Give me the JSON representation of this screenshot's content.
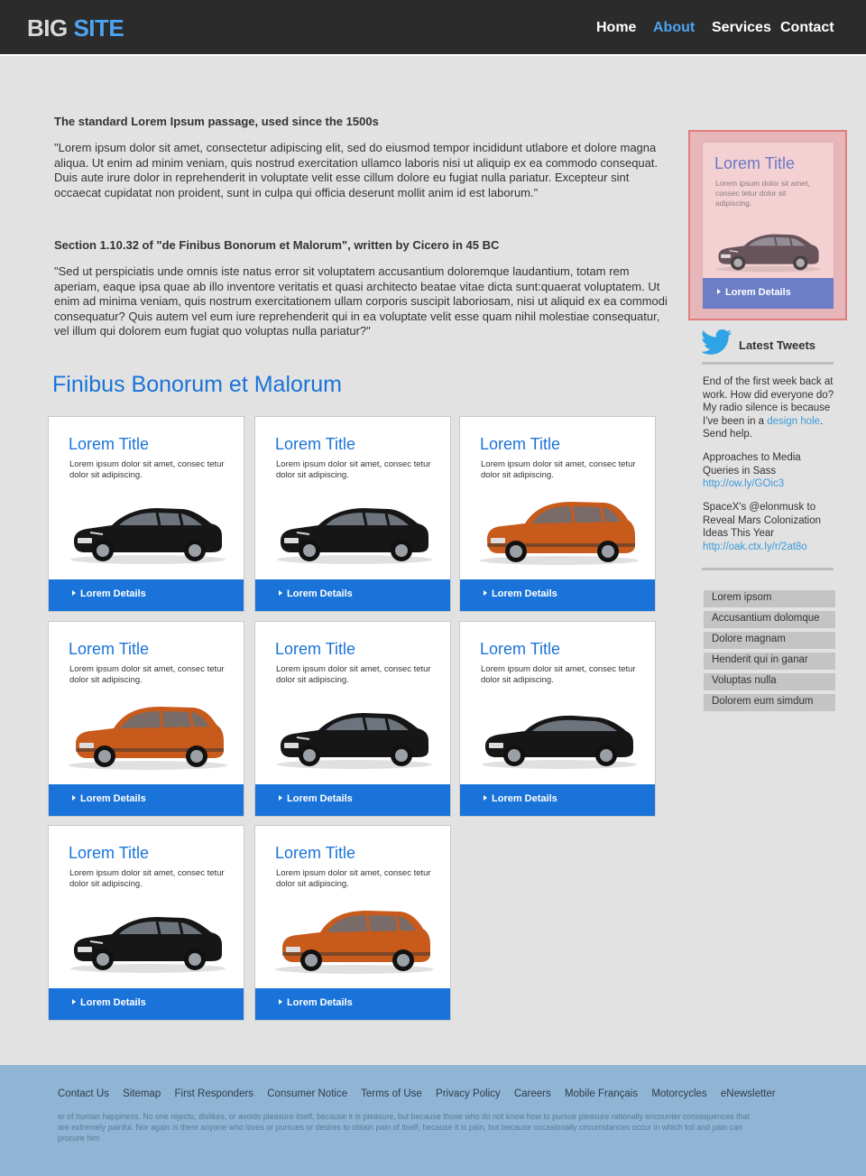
{
  "header": {
    "logo_part1": "BIG",
    "logo_part2": "SITE",
    "nav": [
      "Home",
      "About",
      "Services",
      "Contact"
    ],
    "active_nav": "About"
  },
  "intro": [
    {
      "heading": "The standard Lorem Ipsum passage, used since the 1500s",
      "body": "\"Lorem ipsum dolor sit amet, consectetur adipiscing elit, sed do eiusmod tempor incididunt utlabore et dolore magna aliqua. Ut enim ad minim veniam, quis nostrud exercitation ullamco laboris nisi ut aliquip ex ea commodo consequat. Duis aute irure dolor in reprehenderit in voluptate velit esse cillum dolore eu fugiat nulla pariatur. Excepteur sint occaecat cupidatat non proident, sunt in culpa qui officia deserunt mollit anim id est laborum.\""
    },
    {
      "heading": "Section 1.10.32 of \"de Finibus Bonorum et Malorum\", written by Cicero in 45 BC",
      "body": "\"Sed ut perspiciatis unde omnis iste natus error sit voluptatem accusantium doloremque laudantium, totam rem aperiam, eaque ipsa quae ab illo inventore veritatis et quasi architecto beatae vitae dicta sunt:quaerat voluptatem. Ut enim ad minima veniam, quis nostrum exercitationem ullam corporis suscipit laboriosam, nisi ut aliquid ex ea commodi consequatur? Quis autem vel eum iure reprehenderit qui in ea voluptate velit esse quam nihil molestiae consequatur, vel illum qui dolorem eum fugiat quo voluptas nulla pariatur?\""
    }
  ],
  "section_title": "Finibus Bonorum et Malorum",
  "cards": [
    {
      "title": "Lorem Title",
      "desc": "Lorem ipsum dolor sit amet, consec tetur dolor sit adipiscing.",
      "button": "Lorem Details",
      "car": "black-sedan-icon",
      "car_color": "#161616"
    },
    {
      "title": "Lorem Title",
      "desc": "Lorem ipsum dolor sit amet, consec tetur dolor sit adipiscing.",
      "button": "Lorem Details",
      "car": "black-sedan-icon",
      "car_color": "#161616"
    },
    {
      "title": "Lorem Title",
      "desc": "Lorem ipsum dolor sit amet, consec tetur dolor sit adipiscing.",
      "button": "Lorem Details",
      "car": "orange-suv-icon",
      "car_color": "#c85b1c"
    },
    {
      "title": "Lorem Title",
      "desc": "Lorem ipsum dolor sit amet, consec tetur dolor sit adipiscing.",
      "button": "Lorem Details",
      "car": "orange-suv-icon",
      "car_color": "#c85b1c"
    },
    {
      "title": "Lorem Title",
      "desc": "Lorem ipsum dolor sit amet, consec tetur dolor sit adipiscing.",
      "button": "Lorem Details",
      "car": "black-sedan-icon",
      "car_color": "#161616"
    },
    {
      "title": "Lorem Title",
      "desc": "Lorem ipsum dolor sit amet, consec tetur dolor sit adipiscing.",
      "button": "Lorem Details",
      "car": "black-coupe-icon",
      "car_color": "#161616"
    },
    {
      "title": "Lorem Title",
      "desc": "Lorem ipsum dolor sit amet, consec tetur dolor sit adipiscing.",
      "button": "Lorem Details",
      "car": "black-sedan-icon",
      "car_color": "#161616"
    },
    {
      "title": "Lorem Title",
      "desc": "Lorem ipsum dolor sit amet, consec tetur dolor sit adipiscing.",
      "button": "Lorem Details",
      "car": "orange-suv-icon",
      "car_color": "#c85b1c"
    }
  ],
  "featured": {
    "title": "Lorem Title",
    "desc": "Lorem ipsum dolor sit amet, consec tetur dolor sit adipiscing.",
    "button": "Lorem Details",
    "car": "black-sedan-icon"
  },
  "tweets": {
    "heading": "Latest Tweets",
    "icon": "twitter-bird-icon",
    "t1_text": "End of the first week back at work. How did everyone do? My radio silence is because I've been in a ",
    "t1_link": "design hole",
    "t1_end": ". Send help.",
    "t2_text": "Approaches to Media Queries in Sass",
    "t2_link": "http://ow.ly/GOic3",
    "t3_text": "SpaceX's @elonmusk to Reveal Mars Colonization Ideas This Year",
    "t3_link": "http://oak.ctx.ly/r/2at8o"
  },
  "side_list": [
    "Lorem ipsom",
    "Accusantium dolomque",
    "Dolore magnam",
    "Henderit qui in ganar",
    "Voluptas nulla",
    "Dolorem eum simdum"
  ],
  "footer": {
    "links": [
      "Contact Us",
      "Sitemap",
      "First Responders",
      "Consumer Notice",
      "Terms of Use",
      "Privacy Policy",
      "Careers",
      "Mobile Français",
      "Motorcycles",
      "eNewsletter"
    ],
    "text": "er of human happiness. No one rejects, dislikes, or avoids pleasure itself, because it is pleasure, but because those who do not know how to pursue pleasure rationally encounter consequences that are extremely painful. Nor again is there anyone who loves or pursues or desires to obtain pain of itself, because it is pain, but because occasionally circumstances occur in which toil and pain can procure him"
  },
  "colors": {
    "header_bg": "#2b2b2b",
    "accent": "#1a73d9",
    "logo_accent": "#4da3f0",
    "page_bg": "#e2e2e2",
    "footer_bg": "#8fb4d4",
    "featured_bg": "#f3d1d2",
    "featured_button": "#6b7ec6"
  }
}
